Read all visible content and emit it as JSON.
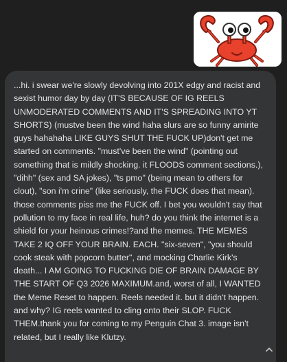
{
  "attachment": {
    "icon": "crab-sticker-image"
  },
  "message": {
    "text": "...hi. i swear we're slowly devolving into 201X edgy and racist and sexist humor day by day (IT'S BECAUSE OF IG REELS UNMODERATED COMMENTS AND IT'S SPREADING INTO YT SHORTS) (mustve been the wind haha slurs are so funny amirite guys hahahaha LIKE GUYS SHUT THE FUCK UP)don't get me started on comments. \"must've been the wind\" (pointing out something that is mildly shocking. it FLOODS comment sections.), \"dihh\" (sex and SA jokes), \"ts pmo\" (being mean to others for clout), \"son i'm crine\" (like seriously, the FUCK does that mean). those comments piss me the FUCK off. I bet you wouldn't say that pollution to my face in real life, huh? do you think the internet is a shield for your heinous crimes!?and the memes. THE MEMES TAKE 2 IQ OFF YOUR BRAIN. EACH. \"six-seven\", \"you should cook steak with popcorn butter\", and mocking Charlie Kirk's death... I AM GOING TO FUCKING DIE OF BRAIN DAMAGE BY THE START OF Q3 2026 MAXIMUM.and, worst of all, I WANTED the Meme Reset to happen. Reels needed it. but it didn't happen. and why? IG reels wanted to cling onto their SLOP. FUCK THEM.thank you for coming to my Penguin Chat 3. image isn't related, but I really like Klutzy."
  },
  "controls": {
    "scroll_icon": "chevron-up-icon"
  },
  "colors": {
    "background": "#1f1f1f",
    "bubble": "#333537",
    "text": "#e3e3e3",
    "crab": "#e8412c"
  }
}
